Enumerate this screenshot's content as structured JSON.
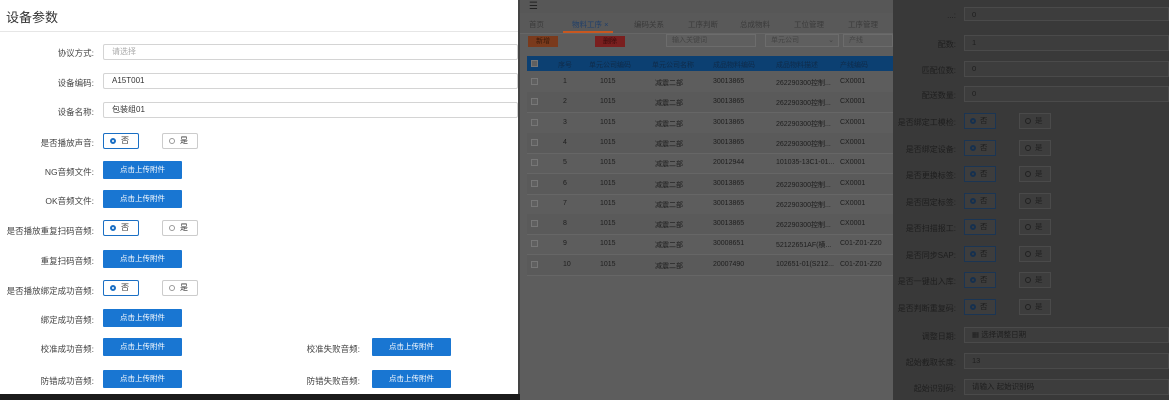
{
  "left": {
    "title": "设备参数",
    "protocol": {
      "label": "协议方式:",
      "placeholder": "请选择"
    },
    "device_code": {
      "label": "设备编码:",
      "value": "A15T001"
    },
    "device_name": {
      "label": "设备名称:",
      "value": "包装组01"
    },
    "radio_no": "否",
    "radio_yes": "是",
    "upload_label": "点击上传附件",
    "play_sound": {
      "label": "是否播放声音:"
    },
    "ng_audio": {
      "label": "NG音频文件:"
    },
    "ok_audio": {
      "label": "OK音频文件:"
    },
    "play_repeat_scan": {
      "label": "是否播放重复扫码音频:"
    },
    "repeat_scan_audio": {
      "label": "重复扫码音频:"
    },
    "play_bind_success": {
      "label": "是否播放绑定成功音频:"
    },
    "bind_success_audio": {
      "label": "绑定成功音频:"
    },
    "calib_success_audio": {
      "label": "校准成功音频:"
    },
    "calib_fail_audio": {
      "label": "校准失败音频:"
    },
    "anti_error_success_audio": {
      "label": "防错成功音频:"
    },
    "anti_error_fail_audio": {
      "label": "防错失败音频:"
    }
  },
  "middle": {
    "tabs": [
      "首页",
      "物料工序",
      "编码关系",
      "工序判断",
      "总成物料",
      "工位管理",
      "工序管理"
    ],
    "tab_close": "×",
    "buttons": {
      "add": "新增",
      "delete": "删除"
    },
    "search_placeholder": "输入关键词",
    "unit_select": "单元公司",
    "line_input": "产线",
    "columns": [
      "序号",
      "单元公司编码",
      "单元公司名称",
      "成品物料编码",
      "成品物料描述",
      "产线编码"
    ],
    "rows": [
      [
        "1",
        "1015",
        "减震二部",
        "30013865",
        "262290300控制...",
        "CX0001"
      ],
      [
        "2",
        "1015",
        "减震二部",
        "30013865",
        "262290300控制...",
        "CX0001"
      ],
      [
        "3",
        "1015",
        "减震二部",
        "30013865",
        "262290300控制...",
        "CX0001"
      ],
      [
        "4",
        "1015",
        "减震二部",
        "30013865",
        "262290300控制...",
        "CX0001"
      ],
      [
        "5",
        "1015",
        "减震二部",
        "20012944",
        "101035-13C1-01...",
        "CX0001"
      ],
      [
        "6",
        "1015",
        "减震二部",
        "30013865",
        "262290300控制...",
        "CX0001"
      ],
      [
        "7",
        "1015",
        "减震二部",
        "30013865",
        "262290300控制...",
        "CX0001"
      ],
      [
        "8",
        "1015",
        "减震二部",
        "30013865",
        "262290300控制...",
        "CX0001"
      ],
      [
        "9",
        "1015",
        "减震二部",
        "30008651",
        "52122651AF(横...",
        "C01-Z01-Z20"
      ],
      [
        "10",
        "1015",
        "减震二部",
        "20007490",
        "102651-01(S212...",
        "C01-Z01-Z20"
      ]
    ]
  },
  "right": {
    "top_partial": {
      "label": "...:",
      "value": "0"
    },
    "match_count": {
      "label": "配数:",
      "value": "1"
    },
    "match_digits": {
      "label": "匹配位数:",
      "value": "0"
    },
    "delivery_qty": {
      "label": "配送数量:",
      "value": "0"
    },
    "radio_no": "否",
    "radio_yes": "是",
    "bind_process_check": {
      "label": "是否绑定工模检:"
    },
    "bind_device": {
      "label": "是否绑定设备:"
    },
    "change_label": {
      "label": "是否更换标签:"
    },
    "fixed_label": {
      "label": "是否固定标签:"
    },
    "scan_report": {
      "label": "是否扫描报工:"
    },
    "sync_sap": {
      "label": "是否同步SAP:"
    },
    "one_click_stock": {
      "label": "是否一键出入库:"
    },
    "check_repeat_code": {
      "label": "是否判断重复码:"
    },
    "adjust_date": {
      "label": "调整日期:",
      "placeholder": "选择调整日期"
    },
    "start_length": {
      "label": "起始截取长度:",
      "value": "13"
    },
    "start_code": {
      "label": "起始识别码:",
      "placeholder": "请输入 起始识别码"
    }
  }
}
